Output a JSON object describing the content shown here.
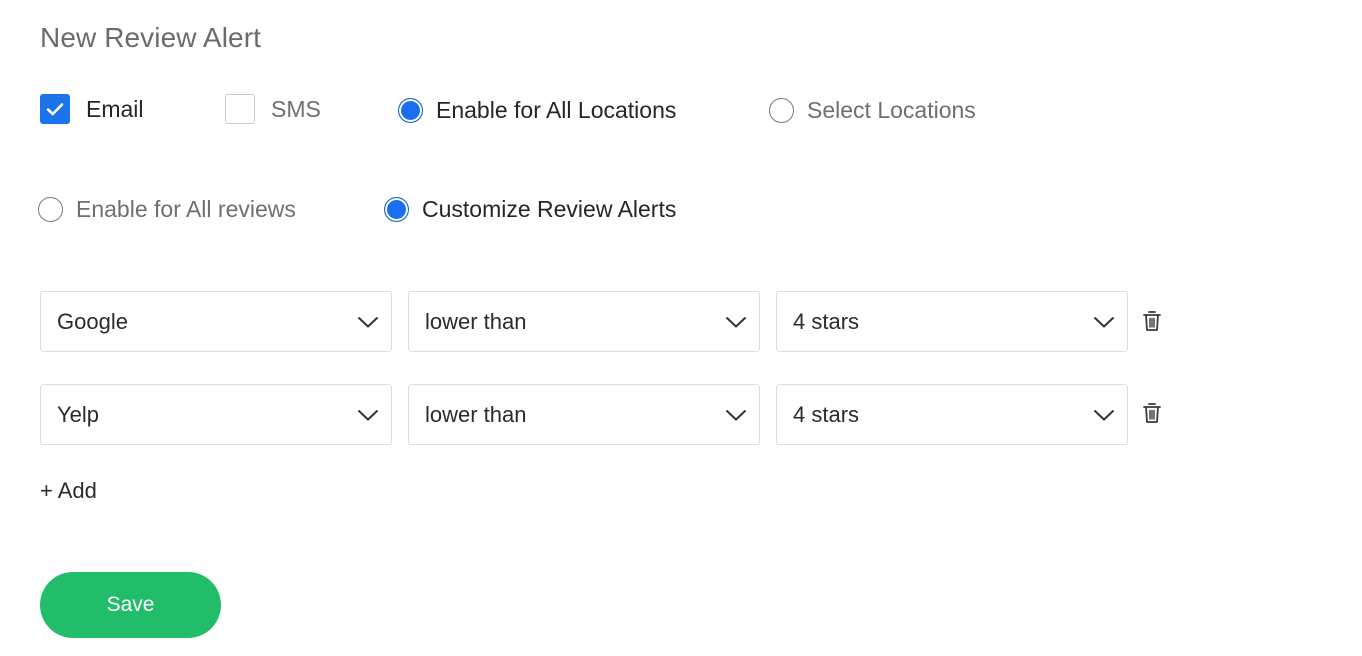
{
  "title": "New Review Alert",
  "channels": {
    "email": {
      "label": "Email",
      "checked": true
    },
    "sms": {
      "label": "SMS",
      "checked": false
    }
  },
  "locations": {
    "all": {
      "label": "Enable for All Locations",
      "selected": true
    },
    "select": {
      "label": "Select Locations",
      "selected": false
    }
  },
  "review_mode": {
    "all": {
      "label": "Enable for All reviews",
      "selected": false
    },
    "custom": {
      "label": "Customize Review Alerts",
      "selected": true
    }
  },
  "rules": [
    {
      "source": "Google",
      "comparator": "lower than",
      "rating": "4 stars"
    },
    {
      "source": "Yelp",
      "comparator": "lower than",
      "rating": "4 stars"
    }
  ],
  "add_label": "+ Add",
  "save_label": "Save",
  "colors": {
    "accent": "#1a73e8",
    "save": "#21bd69",
    "title": "#6b6b6b"
  }
}
